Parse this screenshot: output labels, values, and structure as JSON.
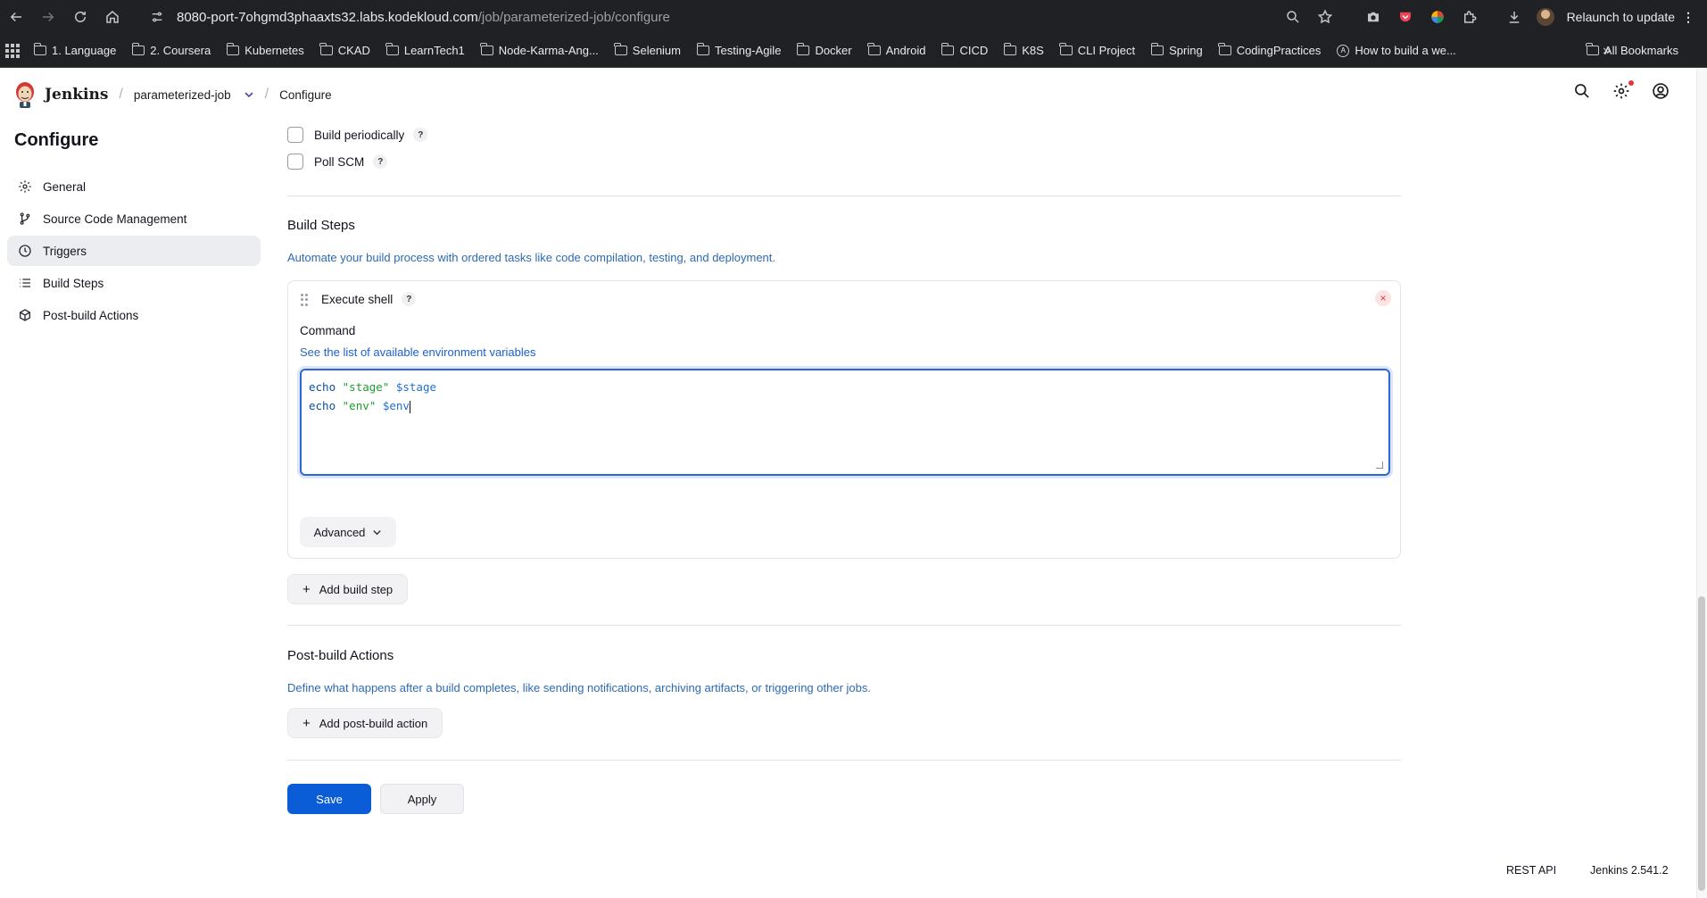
{
  "browser": {
    "url_host": "8080-port-7ohgmd3phaaxts32.labs.kodekloud.com",
    "url_path": "/job/parameterized-job/configure",
    "relaunch_label": "Relaunch to update"
  },
  "bookmarks": {
    "items": [
      "1. Language",
      "2. Coursera",
      "Kubernetes",
      "CKAD",
      "LearnTech1",
      "Node-Karma-Ang...",
      "Selenium",
      "Testing-Agile",
      "Docker",
      "Android",
      "CICD",
      "K8S",
      "CLI Project",
      "Spring",
      "CodingPractices"
    ],
    "special_item": "How to build a we...",
    "more": "»",
    "all": "All Bookmarks"
  },
  "header": {
    "brand": "Jenkins",
    "job_crumb": "parameterized-job",
    "page_crumb": "Configure"
  },
  "sidebar": {
    "title": "Configure",
    "items": [
      {
        "label": "General",
        "icon": "gear-icon"
      },
      {
        "label": "Source Code Management",
        "icon": "branch-icon"
      },
      {
        "label": "Triggers",
        "icon": "clock-icon",
        "active": true
      },
      {
        "label": "Build Steps",
        "icon": "list-icon"
      },
      {
        "label": "Post-build Actions",
        "icon": "package-icon"
      }
    ]
  },
  "triggers": {
    "build_periodically": {
      "label": "Build periodically",
      "checked": false
    },
    "poll_scm": {
      "label": "Poll SCM",
      "checked": false
    },
    "help_glyph": "?"
  },
  "build_steps": {
    "title": "Build Steps",
    "description": "Automate your build process with ordered tasks like code compilation, testing, and deployment.",
    "step": {
      "title": "Execute shell",
      "command_label": "Command",
      "see_prefix": "See",
      "env_link": "the list of available environment variables",
      "code_lines": [
        {
          "kw": "echo",
          "str": "\"stage\"",
          "var": "$stage"
        },
        {
          "kw": "echo",
          "str": "\"env\"",
          "var": "$env"
        }
      ],
      "advanced_label": "Advanced",
      "close_glyph": "×"
    },
    "add_button": "Add build step"
  },
  "post_build": {
    "title": "Post-build Actions",
    "description": "Define what happens after a build completes, like sending notifications, archiving artifacts, or triggering other jobs.",
    "add_button": "Add post-build action"
  },
  "actions": {
    "save": "Save",
    "apply": "Apply"
  },
  "footer": {
    "rest_api": "REST API",
    "version": "Jenkins 2.541.2"
  },
  "colors": {
    "accent": "#0b5dd7",
    "link": "#2d6ab4",
    "chrome_bg": "#202124"
  }
}
